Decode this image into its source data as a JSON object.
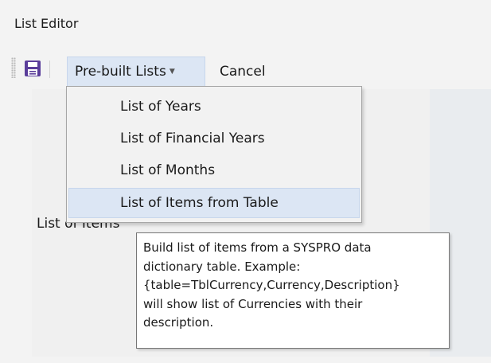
{
  "window": {
    "title": "List Editor"
  },
  "toolbar": {
    "save_icon": "floppy-disk-icon",
    "prebuilt_label": "Pre-built Lists",
    "cancel_label": "Cancel",
    "accent": "#5a3d9a"
  },
  "dropdown": {
    "items": [
      {
        "label": "List of Years"
      },
      {
        "label": "List of Financial Years"
      },
      {
        "label": "List of Months"
      },
      {
        "label": "List of Items from Table",
        "highlighted": true
      }
    ]
  },
  "main": {
    "list_of_items_label": "List of Items"
  },
  "tooltip": {
    "lines": [
      "Build list of items from a SYSPRO data",
      "dictionary table. Example:",
      "{table=TblCurrency,Currency,Description}",
      "will show list of Currencies with their",
      "description."
    ]
  }
}
